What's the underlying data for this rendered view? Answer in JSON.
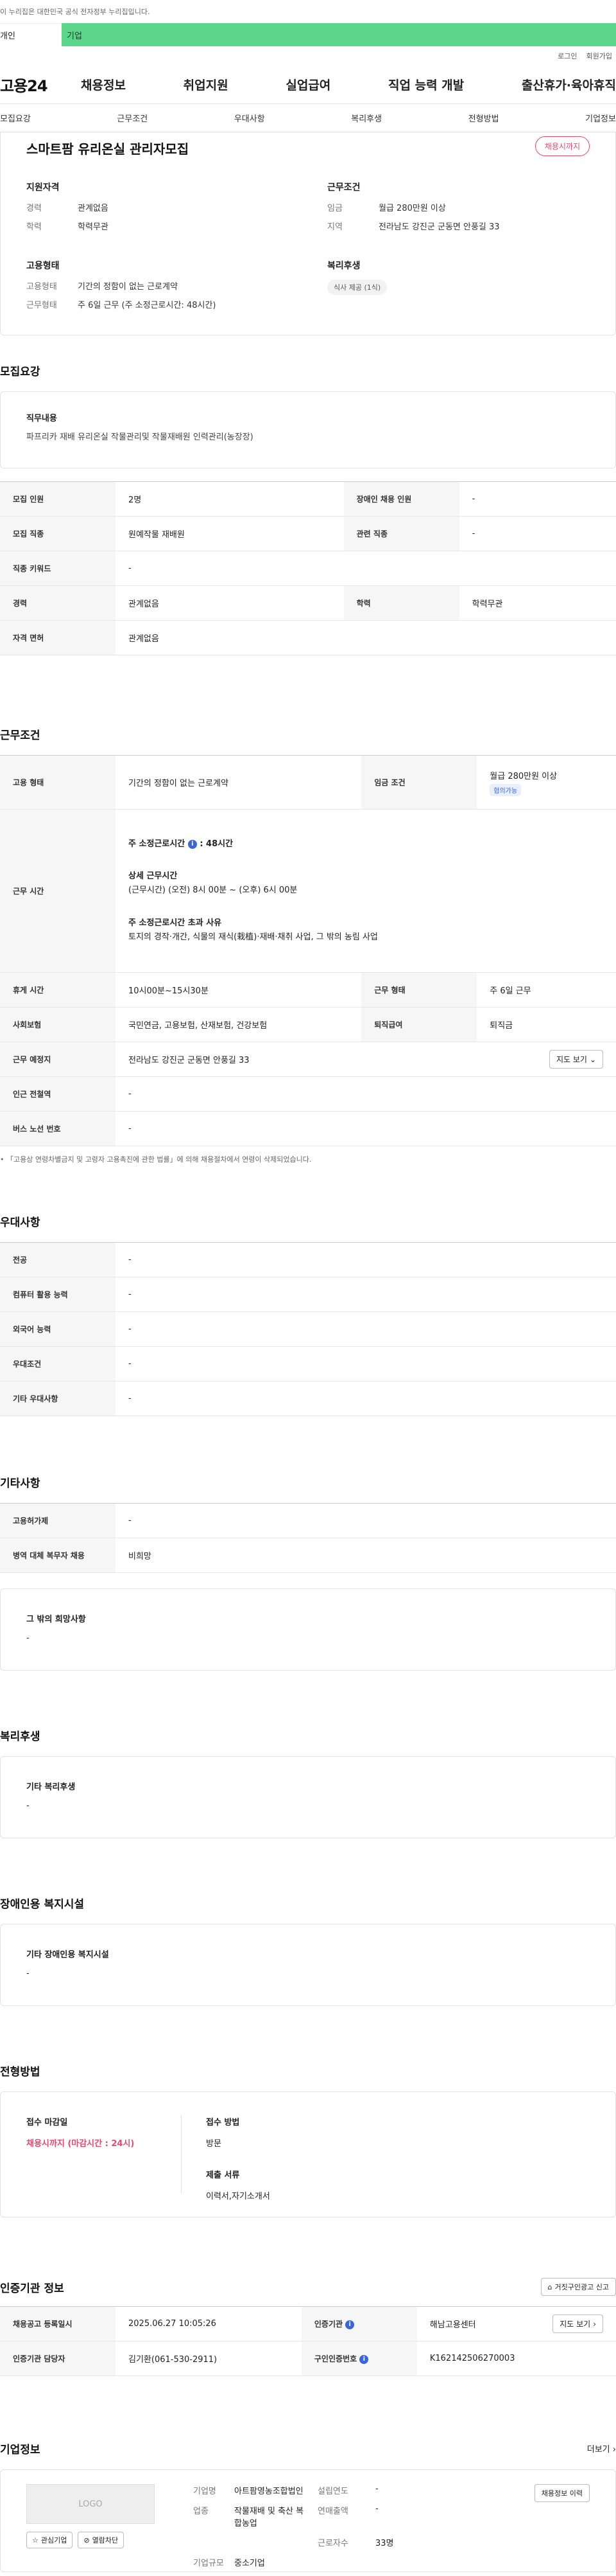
{
  "topbar": {
    "notice": "이 누리집은 대한민국 공식 전자정부 누리집입니다."
  },
  "tabs": {
    "personal": "개인",
    "company": "기업"
  },
  "util": {
    "login": "로그인",
    "join": "회원가입"
  },
  "gnb": {
    "logo": "고용24",
    "items": [
      "채용정보",
      "취업지원",
      "실업급여",
      "직업 능력 개발",
      "출산휴가·육아휴직"
    ]
  },
  "subnav": [
    "모집요강",
    "근무조건",
    "우대사항",
    "복리후생",
    "전형방법",
    "기업정보"
  ],
  "summary": {
    "title": "스마트팜 유리온실 관리자모집",
    "badge": "채용시까지",
    "qual": {
      "head": "지원자격",
      "career_k": "경력",
      "career_v": "관계없음",
      "edu_k": "학력",
      "edu_v": "학력무관"
    },
    "cond": {
      "head": "근무조건",
      "wage_k": "임금",
      "wage_v": "월급 280만원 이상",
      "region_k": "지역",
      "region_v": "전라남도 강진군 군동면 안풍길 33"
    },
    "emp": {
      "head": "고용형태",
      "type_k": "고용형태",
      "type_v": "기간의 정함이 없는 근로계약",
      "form_k": "근무형태",
      "form_v": "주 6일 근무 (주 소정근로시간: 48시간)"
    },
    "welfare": {
      "head": "복리후생",
      "chip": "식사 제공 (1식)"
    }
  },
  "recruit": {
    "title": "모집요강",
    "duty_head": "직무내용",
    "duty_text": "파프리카 재배 유리온실 작물관리및 작물재배원 인력관리(농장장)",
    "rows": {
      "count_k": "모집 인원",
      "count_v": "2명",
      "disabled_k": "장애인 채용 인원",
      "disabled_v": "-",
      "job_k": "모집 직종",
      "job_v": "원예작물 재배원",
      "related_k": "관련 직종",
      "related_v": "-",
      "keyword_k": "직종 키워드",
      "keyword_v": "-",
      "career_k": "경력",
      "career_v": "관계없음",
      "edu_k": "학력",
      "edu_v": "학력무관",
      "license_k": "자격 면허",
      "license_v": "관계없음"
    }
  },
  "work": {
    "title": "근무조건",
    "type_k": "고용 형태",
    "type_v": "기간의 정함이 없는 근로계약",
    "wage_k": "임금 조건",
    "wage_v": "월급 280만원 이상",
    "wage_badge": "협의가능",
    "hours_k": "근무 시간",
    "hours_main": "주 소정근로시간",
    "hours_main_v": ": 48시간",
    "hours_detail_head": "상세 근무시간",
    "hours_detail": "(근무시간) (오전) 8시 00분 ~ (오후) 6시 00분",
    "hours_over_head": "주 소정근로시간 초과 사유",
    "hours_over": "토지의 경작·개간, 식물의 재식(栽植)·재배·채취 사업, 그 밖의 농림 사업",
    "break_k": "휴게 시간",
    "break_v": "10시00분~15시30분",
    "form_k": "근무 형태",
    "form_v": "주 6일 근무",
    "ins_k": "사회보험",
    "ins_v": "국민연금, 고용보험, 산재보험, 건강보험",
    "retire_k": "퇴직급여",
    "retire_v": "퇴직금",
    "place_k": "근무 예정지",
    "place_v": "전라남도 강진군 군동면 안풍길 33",
    "map_btn": "지도 보기",
    "station_k": "인근 전철역",
    "station_v": "-",
    "bus_k": "버스 노선 번호",
    "bus_v": "-",
    "footnote": "「고용상 연령차별금지 및 고령자 고용촉진에 관한 법률」에 의해 채용절차에서 연령이 삭제되었습니다."
  },
  "pref": {
    "title": "우대사항",
    "major_k": "전공",
    "major_v": "-",
    "pc_k": "컴퓨터 활용 능력",
    "pc_v": "-",
    "lang_k": "외국어 능력",
    "lang_v": "-",
    "cond_k": "우대조건",
    "cond_v": "-",
    "etc_k": "기타 우대사항",
    "etc_v": "-"
  },
  "etc": {
    "title": "기타사항",
    "ins_k": "고용허가제",
    "ins_v": "-",
    "mil_k": "병역 대체 복무자 채용",
    "mil_v": "비희망",
    "wish_head": "그 밖의 희망사항",
    "wish_v": "-"
  },
  "welfare": {
    "title": "복리후생",
    "head": "기타 복리후생",
    "v": "-"
  },
  "disabled": {
    "title": "장애인용 복지시설",
    "head": "기타 장애인용 복지시설",
    "v": "-"
  },
  "selection": {
    "title": "전형방법",
    "deadline_head": "접수 마감일",
    "deadline_v": "채용시까지 (마감시간 : 24시)",
    "method_head": "접수 방법",
    "method_v": "방문",
    "docs_head": "제출 서류",
    "docs_v": "이력서,자기소개서"
  },
  "cert": {
    "title": "인증기관 정보",
    "report_btn": "거짓구인광고 신고",
    "reg_k": "채용공고 등록일시",
    "reg_v": "2025.06.27 10:05:26",
    "org_k": "인증기관",
    "org_v": "해남고용센터",
    "map_btn": "지도 보기",
    "mgr_k": "인증기관 담당자",
    "mgr_v": "김기환(061-530-2911)",
    "num_k": "구인인증번호",
    "num_v": "K162142506270003"
  },
  "company": {
    "title": "기업정보",
    "more": "더보기",
    "logo_text": "LOGO",
    "fav_btn": "관심기업",
    "block_btn": "열람차단",
    "name_k": "기업명",
    "name_v": "아트팜영농조합법인",
    "year_k": "설립연도",
    "year_v": "-",
    "ind_k": "업종",
    "ind_v": "작물재배 및 축산 복합농업",
    "sales_k": "연매출액",
    "sales_v": "-",
    "emp_k": "근로자수",
    "emp_v": "33명",
    "size_k": "기업규모",
    "size_v": "중소기업",
    "list_btn": "채용정보 이력"
  }
}
